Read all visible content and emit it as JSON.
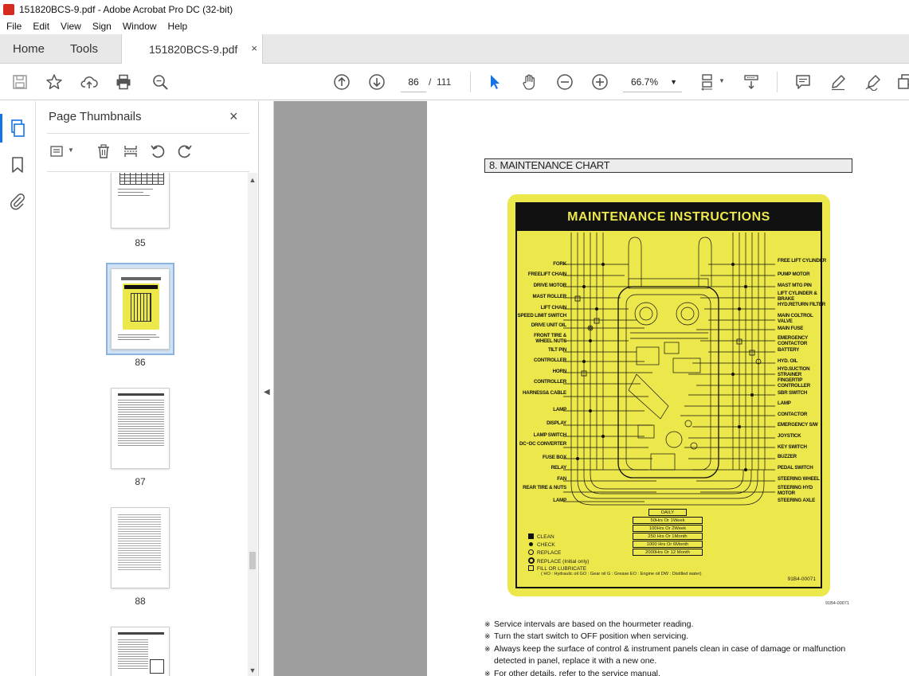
{
  "window": {
    "title": "151820BCS-9.pdf - Adobe Acrobat Pro DC (32-bit)"
  },
  "menu": [
    "File",
    "Edit",
    "View",
    "Sign",
    "Window",
    "Help"
  ],
  "tabs": {
    "home": "Home",
    "tools": "Tools",
    "document": "151820BCS-9.pdf",
    "close": "×"
  },
  "toolbar": {
    "current_page": "86",
    "page_sep": "/",
    "total_pages": "111",
    "zoom": "66.7%"
  },
  "panel": {
    "title": "Page Thumbnails",
    "close": "×",
    "thumbnails": [
      {
        "label": "85"
      },
      {
        "label": "86",
        "selected": true
      },
      {
        "label": "87"
      },
      {
        "label": "88"
      }
    ]
  },
  "document": {
    "heading": "8. MAINTENANCE CHART",
    "decal": {
      "title": "MAINTENANCE  INSTRUCTIONS",
      "left_labels": [
        "FORK",
        "FREELIFT CHAIN",
        "DRIVE MOTOR",
        "MAST ROLLER",
        "LIFT CHAIN",
        "SPEED LIMIT SWITCH",
        "DRIVE UNIT OIL",
        "FRONT TIRE & WHEEL NUTS",
        "TILT PIN",
        "CONTROLLER",
        "HORN",
        "CONTROLLER",
        "HARNESS& CABLE",
        "LAMP",
        "DISPLAY",
        "LAMP SWITCH",
        "DC~DC CONVERTER",
        "FUSE BOX",
        "RELAY",
        "FAN",
        "REAR TIRE & NUTS",
        "LAMP"
      ],
      "right_labels": [
        "FREE LIFT CYLINDER",
        "PUMP MOTOR",
        "MAST MTG PIN",
        "LIFT CYLINDER & BRAKE",
        "HYD.RETURN FILTER",
        "MAIN COLTROL VALVE",
        "MAIN FUSE",
        "EMERGENCY CONTACTOR",
        "BATTERY",
        "HYD. OIL",
        "HYD.SUCTION STRAINER",
        "FINGERTIP CONTROLLER",
        "SBR SWITCH",
        "LAMP",
        "CONTACTOR",
        "EMERGENCY S/W",
        "JOYSTICK",
        "KEY SWITCH",
        "BUZZER",
        "PEDAL SWITCH",
        "STEERING WHEEL",
        "STEERING HYD MOTOR",
        "STEERING AXLE"
      ],
      "intervals": [
        "DAILY",
        "50Hrs  Or  1Week",
        "100Hrs  Or  2Week",
        "250 Hrs  Or  1Month",
        "1000 Hrs  Or  6Month",
        "2000Hrs  Or  12 Month"
      ],
      "legend": [
        "CLEAN",
        "CHECK",
        "REPLACE",
        "REPLACE (Initial only)",
        "FILL OR LUBRICATE"
      ],
      "legend_bottom": "( HO : Hydraulic oil   GO : Gear oil   G : Grease   EO : Engine oil   DW : Distilled water)",
      "code": "91B4-00071"
    },
    "page_code": "91B4-00071",
    "notes": [
      "Service intervals are based on the hourmeter reading.",
      "Turn the start switch to OFF position when servicing.",
      "Always keep the surface of control & instrument panels clean in case of damage or malfunction detected in panel, replace it with a new one.",
      "For other details, refer to the service manual."
    ]
  },
  "colors": {
    "decal_yellow": "#ece74a",
    "accent_blue": "#1473e6",
    "canvas_gray": "#9e9e9e"
  }
}
